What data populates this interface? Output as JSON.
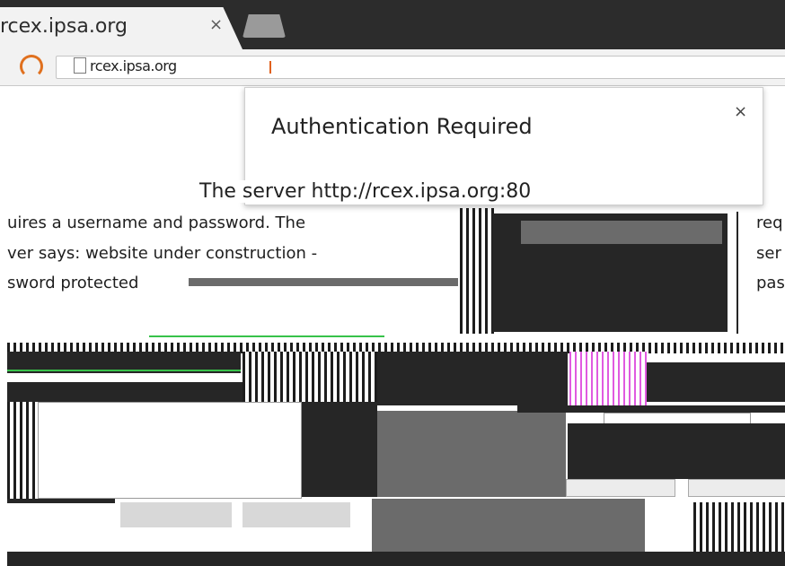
{
  "browser": {
    "tab_title": "rcex.ipsa.org",
    "tab_close": "×",
    "url": "rcex.ipsa.org"
  },
  "dialog": {
    "title": "Authentication Required",
    "close": "×",
    "server_line": "The server http://rcex.ipsa.org:80"
  },
  "background_page": {
    "lines_left": [
      "uires a username and password. The",
      "ver says: website under construction -",
      "sword protected"
    ],
    "lines_right": [
      "req",
      "ser",
      "pas"
    ]
  },
  "icons": {
    "reload": "reload-icon",
    "page": "page-icon"
  },
  "colors": {
    "tabstrip": "#2c2c2c",
    "accent": "#e0701e"
  }
}
